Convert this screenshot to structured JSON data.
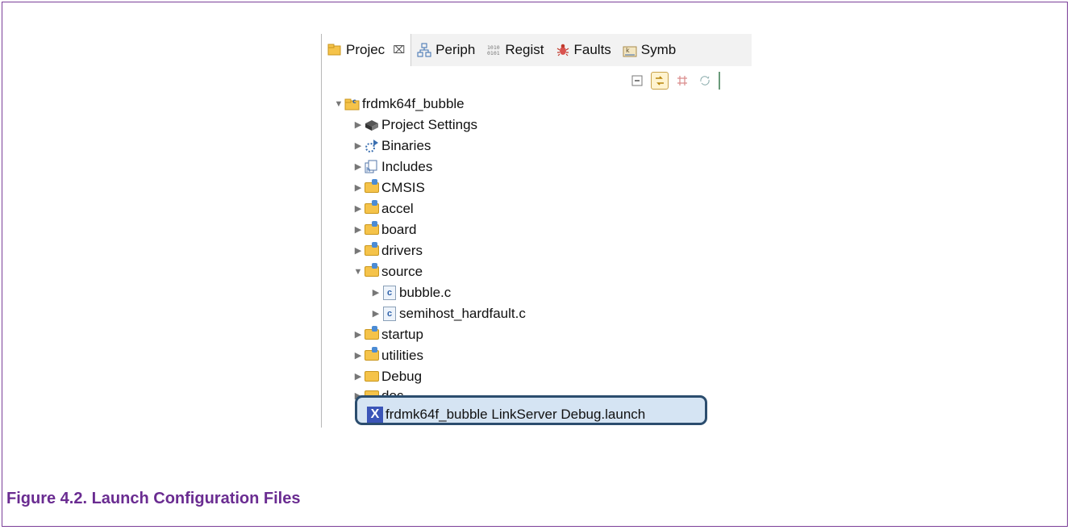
{
  "tabs": [
    {
      "label": "Projec",
      "icon": "project-explorer-icon",
      "close": "⌧"
    },
    {
      "label": "Periph",
      "icon": "peripherals-icon"
    },
    {
      "label": "Regist",
      "icon": "registers-icon",
      "glyph": "1010\n0101"
    },
    {
      "label": "Faults",
      "icon": "faults-bug-icon"
    },
    {
      "label": "Symb",
      "icon": "symbols-icon"
    }
  ],
  "toolbar": [
    "collapse-all-icon",
    "link-with-editor-icon",
    "filter-icon",
    "sync-icon"
  ],
  "tree": {
    "root": "frdmk64f_bubble",
    "items": [
      {
        "label": "Project Settings",
        "icon": "settings-icon"
      },
      {
        "label": "Binaries",
        "icon": "binaries-icon"
      },
      {
        "label": "Includes",
        "icon": "includes-icon"
      },
      {
        "label": "CMSIS",
        "icon": "source-folder-icon"
      },
      {
        "label": "accel",
        "icon": "source-folder-icon"
      },
      {
        "label": "board",
        "icon": "source-folder-icon"
      },
      {
        "label": "drivers",
        "icon": "source-folder-icon"
      },
      {
        "label": "source",
        "icon": "source-folder-icon"
      },
      {
        "label": "bubble.c",
        "icon": "c-file-icon"
      },
      {
        "label": "semihost_hardfault.c",
        "icon": "c-file-icon"
      },
      {
        "label": "startup",
        "icon": "source-folder-icon"
      },
      {
        "label": "utilities",
        "icon": "source-folder-icon"
      },
      {
        "label": "Debug",
        "icon": "folder-icon"
      },
      {
        "label": "doc",
        "icon": "folder-icon"
      }
    ],
    "launch_file": "frdmk64f_bubble LinkServer Debug.launch"
  },
  "caption": "Figure 4.2. Launch Configuration Files",
  "colors": {
    "caption": "#6a2c91",
    "frame": "#7b3f99",
    "highlight": "#2b4d6e"
  }
}
